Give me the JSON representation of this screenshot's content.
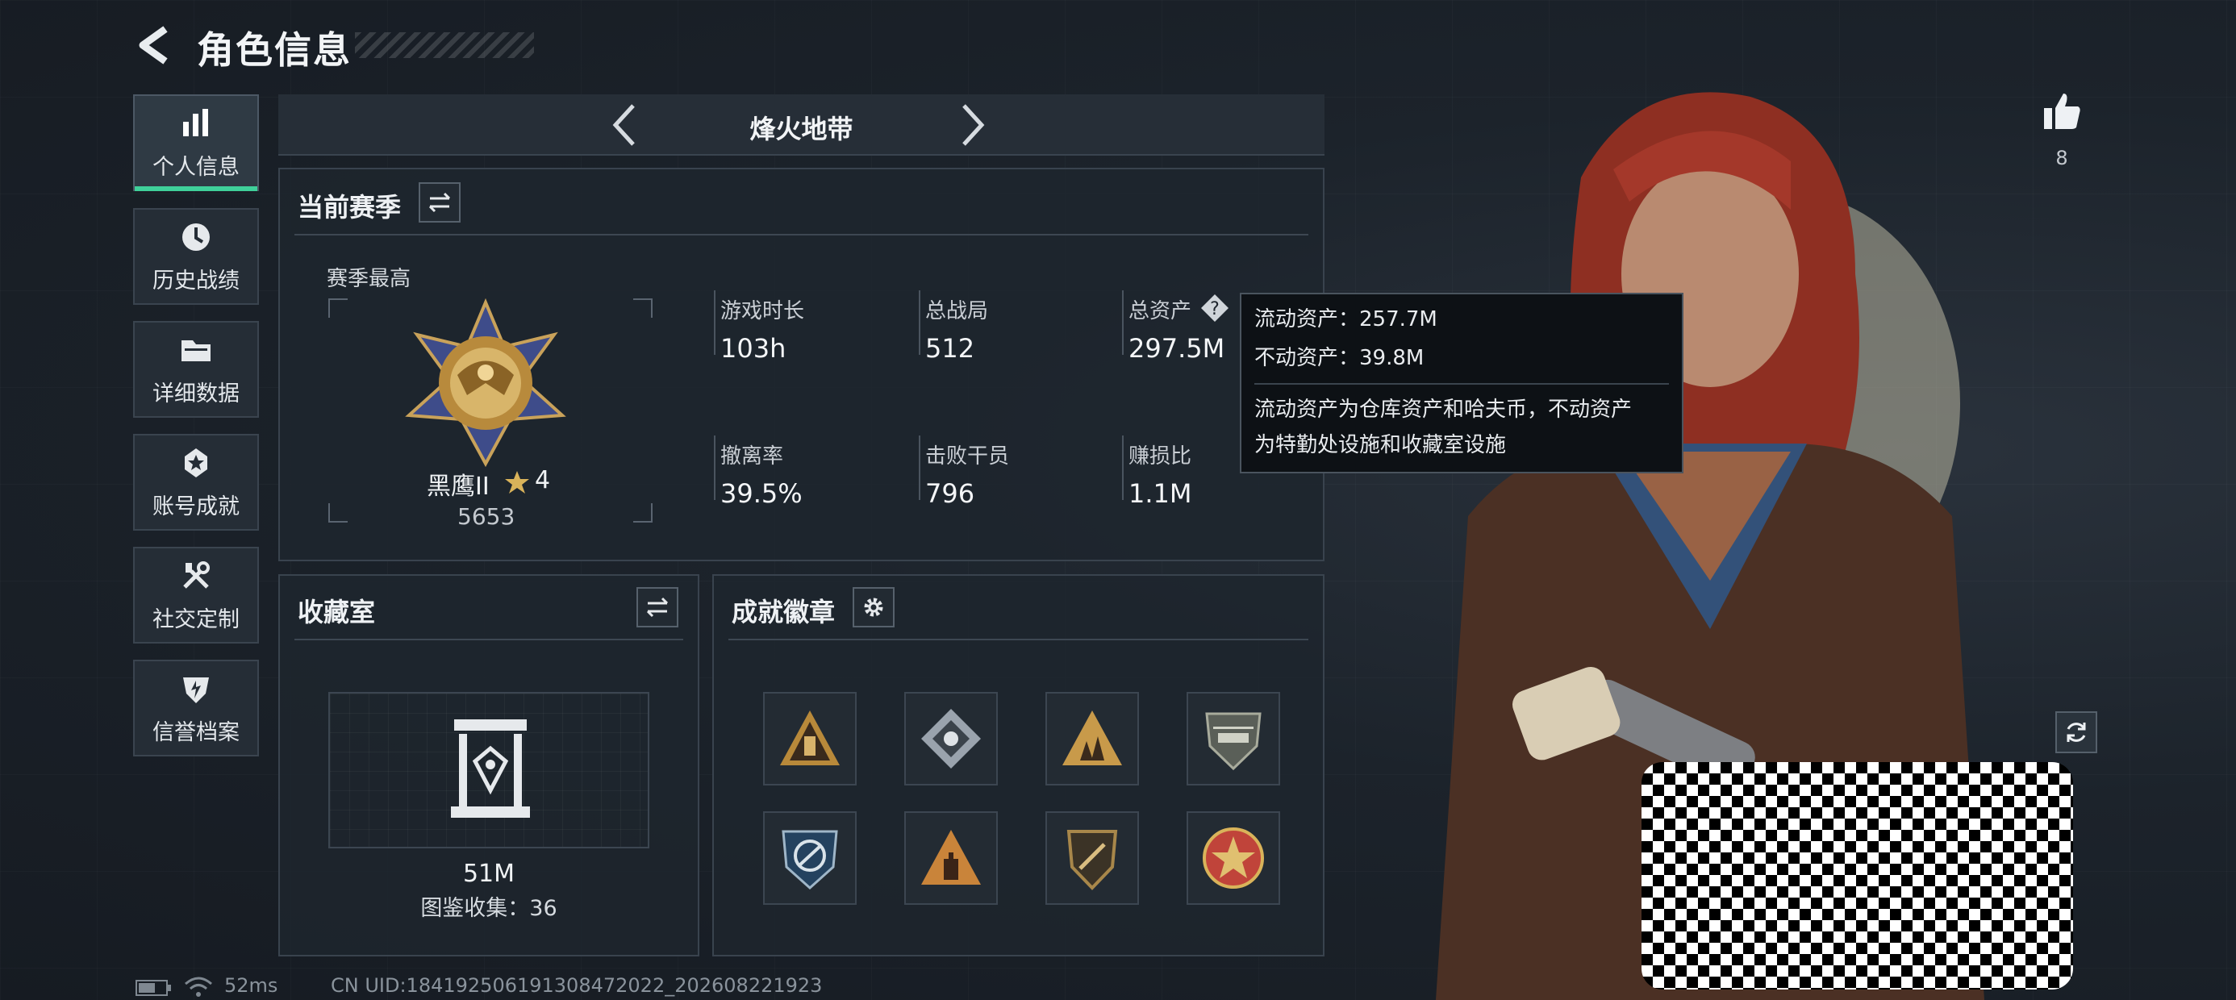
{
  "header": {
    "title": "角色信息"
  },
  "nav": [
    {
      "label": "个人信息",
      "icon": "bar-chart-icon",
      "active": true
    },
    {
      "label": "历史战绩",
      "icon": "clock-icon",
      "active": false
    },
    {
      "label": "详细数据",
      "icon": "folder-icon",
      "active": false
    },
    {
      "label": "账号成就",
      "icon": "medal-icon",
      "active": false
    },
    {
      "label": "社交定制",
      "icon": "tools-icon",
      "active": false
    },
    {
      "label": "信誉档案",
      "icon": "shield-icon",
      "active": false
    }
  ],
  "season": {
    "name": "烽火地带"
  },
  "current_season": {
    "title": "当前赛季",
    "best_label": "赛季最高",
    "rank_name": "黑鹰II",
    "rank_stars": "4",
    "rank_points": "5653",
    "stats": [
      {
        "label": "游戏时长",
        "value": "103h"
      },
      {
        "label": "总战局",
        "value": "512"
      },
      {
        "label": "总资产",
        "value": "297.5M"
      },
      {
        "label": "撤离率",
        "value": "39.5%"
      },
      {
        "label": "击败干员",
        "value": "796"
      },
      {
        "label": "赚损比",
        "value": "1.1M"
      }
    ]
  },
  "tooltip": {
    "liquid": "流动资产：257.7M",
    "fixed": "不动资产：39.8M",
    "desc_line1": "流动资产为仓库资产和哈夫币，不动资产",
    "desc_line2": "为特勤处设施和收藏室设施"
  },
  "collection": {
    "title": "收藏室",
    "value": "51M",
    "catalog": "图鉴收集：36"
  },
  "achievements": {
    "title": "成就徽章",
    "badges": [
      {
        "icon": "triangle-badge-icon",
        "color": "#b8893a"
      },
      {
        "icon": "diamond-badge-icon",
        "color": "#9aa3ad"
      },
      {
        "icon": "triangle-soldiers-badge-icon",
        "color": "#c89a4a"
      },
      {
        "icon": "helicopter-shield-badge-icon",
        "color": "#8a8f86"
      },
      {
        "icon": "blue-shield-badge-icon",
        "color": "#3a6fa0"
      },
      {
        "icon": "hand-triangle-badge-icon",
        "color": "#c9843a"
      },
      {
        "icon": "gold-shield-badge-icon",
        "color": "#a8874a"
      },
      {
        "icon": "star-emblem-badge-icon",
        "color": "#c0443a"
      }
    ]
  },
  "right": {
    "likes": "8"
  },
  "status_bar": {
    "ping": "52ms",
    "uid": "CN UID:18419250619130847202​2_202608221923"
  },
  "colors": {
    "accent": "#3fd09a",
    "panel": "#1e252d",
    "border": "#39434e"
  }
}
